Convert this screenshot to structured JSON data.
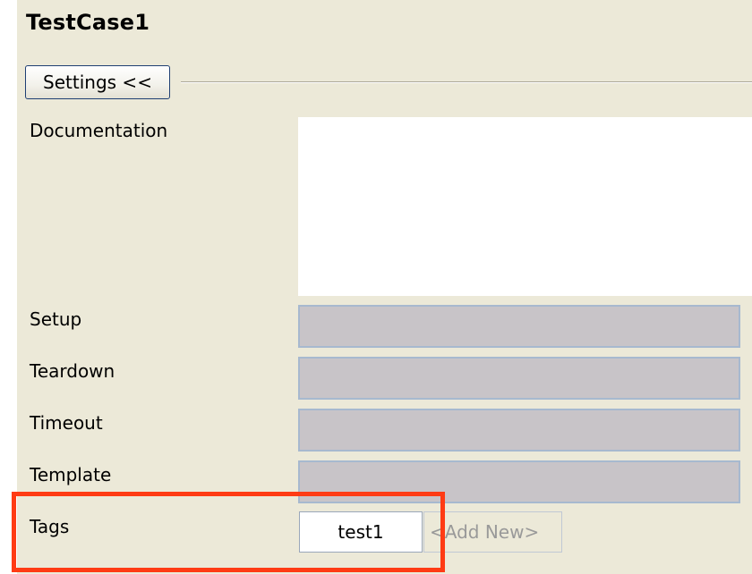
{
  "editor": {
    "title": "TestCase1",
    "settings_button": "Settings <<",
    "fields": {
      "documentation": {
        "label": "Documentation",
        "value": ""
      },
      "setup": {
        "label": "Setup",
        "value": ""
      },
      "teardown": {
        "label": "Teardown",
        "value": ""
      },
      "timeout": {
        "label": "Timeout",
        "value": ""
      },
      "template": {
        "label": "Template",
        "value": ""
      }
    },
    "tags": {
      "label": "Tags",
      "items": [
        "test1"
      ],
      "add_new": "<Add New>"
    }
  },
  "colors": {
    "panel_background": "#ece9d8",
    "disabled_field": "#c8c4c8",
    "highlight_outline": "#ff3b14"
  }
}
